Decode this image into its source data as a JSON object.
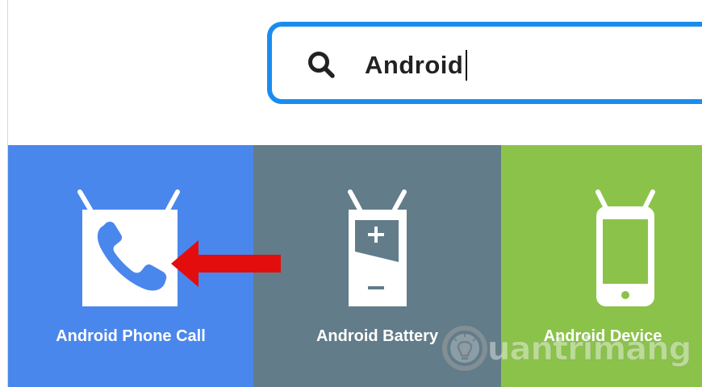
{
  "search": {
    "value": "Android"
  },
  "tiles": [
    {
      "label": "Android Phone Call",
      "color": "#4a87ec",
      "icon": "phone-call-icon"
    },
    {
      "label": "Android Battery",
      "color": "#627c89",
      "icon": "battery-icon"
    },
    {
      "label": "Android Device",
      "color": "#8bc34a",
      "icon": "smartphone-icon"
    }
  ],
  "watermark": {
    "text": "uantrimang"
  },
  "colors": {
    "search_border": "#1a8cf0",
    "arrow": "#e30d0d"
  }
}
